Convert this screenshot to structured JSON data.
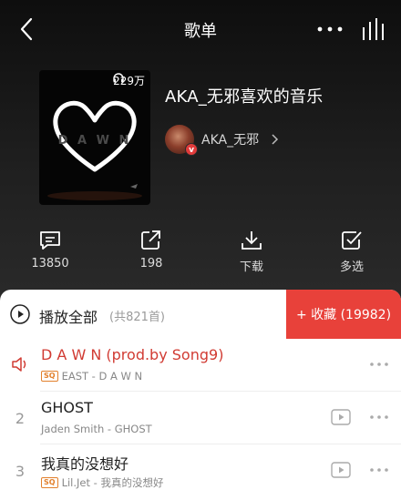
{
  "topbar": {
    "title": "歌单"
  },
  "playlist": {
    "title": "AKA_无邪喜欢的音乐",
    "play_count": "229万",
    "cover_text": "D A W N",
    "creator": {
      "name": "AKA_无邪",
      "badge": "v"
    }
  },
  "actions": {
    "comment": "13850",
    "share": "198",
    "download": "下载",
    "multiselect": "多选"
  },
  "list": {
    "play_all": "播放全部",
    "count": "(共821首)",
    "collect": "+ 收藏 (19982)",
    "songs": [
      {
        "index": "",
        "title": "D A W N (prod.by Song9)",
        "sq": "SQ",
        "subtitle": "EAST - D A W N",
        "playing": true
      },
      {
        "index": "2",
        "title": "GHOST",
        "sq": "",
        "subtitle": "Jaden Smith - GHOST",
        "playing": false
      },
      {
        "index": "3",
        "title": "我真的没想好",
        "sq": "SQ",
        "subtitle": "Lil.Jet - 我真的没想好",
        "playing": false
      }
    ]
  },
  "colors": {
    "accent": "#e8413a",
    "playing_text": "#d13b33",
    "sq_badge": "#e2802c"
  }
}
